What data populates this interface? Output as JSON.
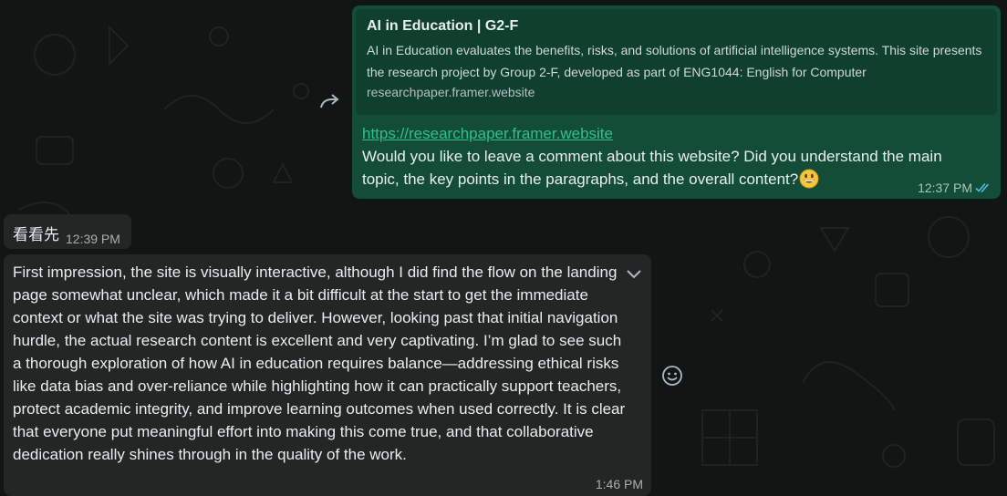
{
  "outgoing": {
    "preview": {
      "title": "AI in Education | G2-F",
      "description": "AI in Education evaluates the benefits, risks, and solutions of artificial intelligence systems. This site presents the research project by Group 2-F, developed as part of ENG1044: English for Computer",
      "domain": "researchpaper.framer.website"
    },
    "link": "https://researchpaper.framer.website",
    "text": "Would you like to leave a comment about this website? Did you understand the main topic, the key points in the paragraphs, and the overall content?",
    "time": "12:37 PM",
    "status_icon": "double-check-read-icon"
  },
  "incoming_short": {
    "text": "看看先",
    "time": "12:39 PM"
  },
  "incoming_long": {
    "text": "First impression, the site is visually interactive, although I did find the flow on the landing page somewhat unclear, which made it a bit difficult at the start to get the immediate context or what the site was trying to deliver. However, looking past that initial navigation hurdle, the actual research content is excellent and very captivating. I’m glad to see such a thorough exploration of how AI in education requires balance—addressing ethical risks like data bias and over-reliance while highlighting how it can practically support teachers, protect academic integrity, and improve learning outcomes when used correctly. It is clear that everyone put meaningful effort into making this come true, and that collaborative dedication really shines through in the quality of the work.",
    "time": "1:46 PM"
  },
  "colors": {
    "outgoing_bubble": "#144d37",
    "incoming_bubble": "#242626",
    "link": "#2fc08a",
    "read_ticks": "#53bdeb"
  }
}
